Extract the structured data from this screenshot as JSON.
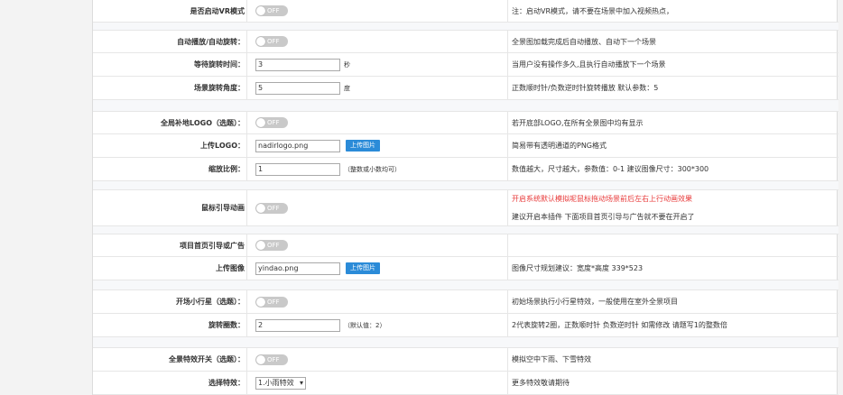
{
  "toggle_off_text": "OFF",
  "colors": {
    "button": "#2b8bd8",
    "warning": "#e83b3b",
    "toggle_off": "#c9c9c9"
  },
  "rows": {
    "vr": {
      "label": "是否启动VR模式",
      "note": "注：启动VR模式，请不要在场景中加入视频热点，"
    },
    "autoplay": {
      "label": "自动播放/自动旋转：",
      "note": "全景图加载完成后自动播放、自动下一个场景"
    },
    "wait": {
      "label": "等待旋转时间：",
      "value": "3",
      "unit": "秒",
      "note": "当用户没有操作多久,且执行自动播放下一个场景"
    },
    "angle": {
      "label": "场景旋转角度：",
      "value": "5",
      "unit": "度",
      "note": "正数顺时针/负数逆时针旋转播放 默认参数：5"
    },
    "logo": {
      "label": "全局补地LOGO（选题）：",
      "note": "若开底部LOGO,在所有全景图中均有显示"
    },
    "upload_logo": {
      "label": "上传LOGO：",
      "value": "nadirlogo.png",
      "button": "上传图片",
      "note": "简易带有透明通道的PNG格式"
    },
    "scale": {
      "label": "缩放比例：",
      "value": "1",
      "unit": "（整数或小数均可）",
      "note": "数值越大，尺寸越大，参数值：0-1 建议图像尺寸：300*300"
    },
    "mouse": {
      "label": "鼠标引导动画",
      "note_warning": "开启系统默认模拟呢鼠标拖动场景前后左右上行动画效果",
      "note": "建议开启本插件 下面项目首页引导与广告就不要在开启了"
    },
    "guide": {
      "label": "项目首页引导或广告"
    },
    "upload_guide": {
      "label": "上传图像",
      "value": "yindao.png",
      "button": "上传图片",
      "note": "图像尺寸规划建议：宽度*高度 339*523"
    },
    "stars": {
      "label": "开场小行星（选题）：",
      "note": "初始场景执行小行星特效，一般使用在室外全景项目"
    },
    "rotations": {
      "label": "旋转圈数：",
      "value": "2",
      "unit": "（默认值：2）",
      "note": "2代表旋转2圈，正数顺时针 负数逆时针 如需修改 请题写1的整数倍"
    },
    "effects": {
      "label": "全景特效开关（选题）：",
      "note": "模拟空中下雨、下雪特效"
    },
    "choose_effect": {
      "label": "选择特效：",
      "selected": "1.小雨特效",
      "note": "更多特效敬请期待"
    }
  }
}
